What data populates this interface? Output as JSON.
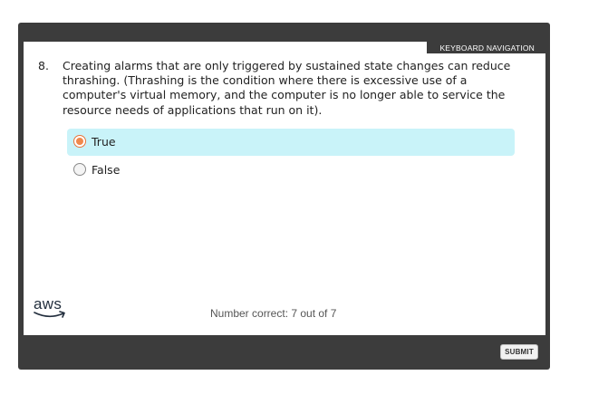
{
  "header": {
    "keyboard_navigation": "KEYBOARD NAVIGATION"
  },
  "question": {
    "number": "8.",
    "text": "Creating alarms that are only triggered by sustained state changes can reduce thrashing. (Thrashing is the condition where there is excessive use of a computer's virtual memory, and the computer is no longer able to service the resource needs of applications that run on it).",
    "options": [
      {
        "label": "True",
        "selected": true
      },
      {
        "label": "False",
        "selected": false
      }
    ]
  },
  "footer": {
    "logo_text": "aws",
    "score_text": "Number correct: 7 out of 7",
    "submit_label": "SUBMIT"
  },
  "colors": {
    "frame": "#3c3c3c",
    "selected_option_bg": "#c9f3f9",
    "radio_accent": "#f0884c"
  }
}
